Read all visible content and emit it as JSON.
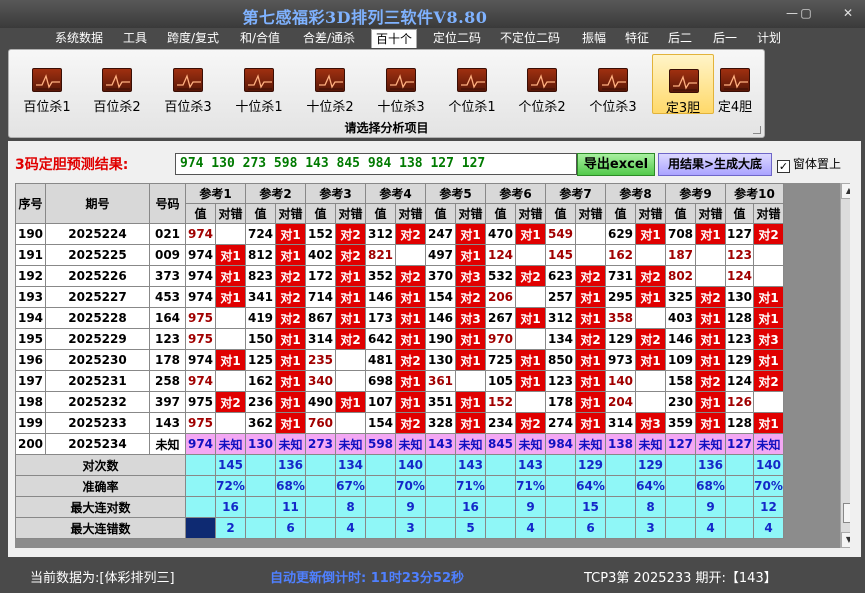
{
  "window": {
    "title": "第七感福彩3D排列三软件V8.80",
    "min": "—",
    "max": "▢",
    "close": "✕"
  },
  "menu": [
    "系统数据",
    "工具",
    "跨度/复式",
    "和/合值",
    "合差/通杀",
    "百十个",
    "定位二码",
    "不定位二码",
    "振幅",
    "特征",
    "后二",
    "后一",
    "计划"
  ],
  "menu_active": "百十个",
  "ribbon": {
    "buttons": [
      "百位杀1",
      "百位杀2",
      "百位杀3",
      "十位杀1",
      "十位杀2",
      "十位杀3",
      "个位杀1",
      "个位杀2",
      "个位杀3",
      "定3胆",
      "定4胆"
    ],
    "active": "定3胆",
    "caption": "请选择分析项目"
  },
  "result": {
    "label": "3码定胆预测结果:",
    "value": "974 130 273 598 143 845 984 138 127 127",
    "export_label": "导出excel",
    "apply_label": "用结果>生成大底",
    "pin_label": "窗体置上",
    "pin_checked": "✓"
  },
  "table": {
    "headers": {
      "seq": "序号",
      "period": "期号",
      "code": "号码",
      "value": "值",
      "mark": "对错"
    },
    "refs": [
      "参考1",
      "参考2",
      "参考3",
      "参考4",
      "参考5",
      "参考6",
      "参考7",
      "参考8",
      "参考9",
      "参考10"
    ],
    "rows": [
      {
        "seq": "190",
        "period": "2025224",
        "code": "021",
        "cells": [
          [
            "974",
            ""
          ],
          [
            "724",
            "对1"
          ],
          [
            "152",
            "对2"
          ],
          [
            "312",
            "对2"
          ],
          [
            "247",
            "对1"
          ],
          [
            "470",
            "对1"
          ],
          [
            "549",
            ""
          ],
          [
            "629",
            "对1"
          ],
          [
            "708",
            "对1"
          ],
          [
            "127",
            "对2"
          ]
        ]
      },
      {
        "seq": "191",
        "period": "2025225",
        "code": "009",
        "cells": [
          [
            "974",
            "对1"
          ],
          [
            "812",
            "对1"
          ],
          [
            "402",
            "对2"
          ],
          [
            "821",
            ""
          ],
          [
            "497",
            "对1"
          ],
          [
            "124",
            ""
          ],
          [
            "145",
            ""
          ],
          [
            "162",
            ""
          ],
          [
            "187",
            ""
          ],
          [
            "123",
            ""
          ]
        ]
      },
      {
        "seq": "192",
        "period": "2025226",
        "code": "373",
        "cells": [
          [
            "974",
            "对1"
          ],
          [
            "823",
            "对2"
          ],
          [
            "172",
            "对1"
          ],
          [
            "352",
            "对2"
          ],
          [
            "370",
            "对3"
          ],
          [
            "532",
            "对2"
          ],
          [
            "623",
            "对2"
          ],
          [
            "731",
            "对2"
          ],
          [
            "802",
            ""
          ],
          [
            "124",
            ""
          ]
        ]
      },
      {
        "seq": "193",
        "period": "2025227",
        "code": "453",
        "cells": [
          [
            "974",
            "对1"
          ],
          [
            "341",
            "对2"
          ],
          [
            "714",
            "对1"
          ],
          [
            "146",
            "对1"
          ],
          [
            "154",
            "对2"
          ],
          [
            "206",
            ""
          ],
          [
            "257",
            "对1"
          ],
          [
            "295",
            "对1"
          ],
          [
            "325",
            "对2"
          ],
          [
            "130",
            "对1"
          ]
        ]
      },
      {
        "seq": "194",
        "period": "2025228",
        "code": "164",
        "cells": [
          [
            "975",
            ""
          ],
          [
            "419",
            "对2"
          ],
          [
            "867",
            "对1"
          ],
          [
            "173",
            "对1"
          ],
          [
            "146",
            "对3"
          ],
          [
            "267",
            "对1"
          ],
          [
            "312",
            "对1"
          ],
          [
            "358",
            ""
          ],
          [
            "403",
            "对1"
          ],
          [
            "128",
            "对1"
          ]
        ]
      },
      {
        "seq": "195",
        "period": "2025229",
        "code": "123",
        "cells": [
          [
            "975",
            ""
          ],
          [
            "150",
            "对1"
          ],
          [
            "314",
            "对2"
          ],
          [
            "642",
            "对1"
          ],
          [
            "190",
            "对1"
          ],
          [
            "970",
            ""
          ],
          [
            "134",
            "对2"
          ],
          [
            "129",
            "对2"
          ],
          [
            "146",
            "对1"
          ],
          [
            "123",
            "对3"
          ]
        ]
      },
      {
        "seq": "196",
        "period": "2025230",
        "code": "178",
        "cells": [
          [
            "974",
            "对1"
          ],
          [
            "125",
            "对1"
          ],
          [
            "235",
            ""
          ],
          [
            "481",
            "对2"
          ],
          [
            "130",
            "对1"
          ],
          [
            "725",
            "对1"
          ],
          [
            "850",
            "对1"
          ],
          [
            "973",
            "对1"
          ],
          [
            "109",
            "对1"
          ],
          [
            "129",
            "对1"
          ]
        ]
      },
      {
        "seq": "197",
        "period": "2025231",
        "code": "258",
        "cells": [
          [
            "974",
            ""
          ],
          [
            "162",
            "对1"
          ],
          [
            "340",
            ""
          ],
          [
            "698",
            "对1"
          ],
          [
            "361",
            ""
          ],
          [
            "105",
            "对1"
          ],
          [
            "123",
            "对1"
          ],
          [
            "140",
            ""
          ],
          [
            "158",
            "对2"
          ],
          [
            "124",
            "对2"
          ]
        ]
      },
      {
        "seq": "198",
        "period": "2025232",
        "code": "397",
        "cells": [
          [
            "975",
            "对2"
          ],
          [
            "236",
            "对1"
          ],
          [
            "490",
            "对1"
          ],
          [
            "107",
            "对1"
          ],
          [
            "351",
            "对1"
          ],
          [
            "152",
            ""
          ],
          [
            "178",
            "对1"
          ],
          [
            "204",
            ""
          ],
          [
            "230",
            "对1"
          ],
          [
            "126",
            ""
          ]
        ]
      },
      {
        "seq": "199",
        "period": "2025233",
        "code": "143",
        "cells": [
          [
            "975",
            ""
          ],
          [
            "362",
            "对1"
          ],
          [
            "760",
            ""
          ],
          [
            "154",
            "对2"
          ],
          [
            "328",
            "对1"
          ],
          [
            "234",
            "对2"
          ],
          [
            "274",
            "对1"
          ],
          [
            "314",
            "对3"
          ],
          [
            "359",
            "对1"
          ],
          [
            "128",
            "对1"
          ]
        ]
      },
      {
        "seq": "200",
        "period": "2025234",
        "code": "未知",
        "cells": [
          [
            "974",
            "未知"
          ],
          [
            "130",
            "未知"
          ],
          [
            "273",
            "未知"
          ],
          [
            "598",
            "未知"
          ],
          [
            "143",
            "未知"
          ],
          [
            "845",
            "未知"
          ],
          [
            "984",
            "未知"
          ],
          [
            "138",
            "未知"
          ],
          [
            "127",
            "未知"
          ],
          [
            "127",
            "未知"
          ]
        ]
      }
    ],
    "stats": [
      {
        "label": "对次数",
        "values": [
          "145",
          "136",
          "134",
          "140",
          "143",
          "143",
          "129",
          "129",
          "136",
          "140"
        ]
      },
      {
        "label": "准确率",
        "values": [
          "72%",
          "68%",
          "67%",
          "70%",
          "71%",
          "71%",
          "64%",
          "64%",
          "68%",
          "70%"
        ]
      },
      {
        "label": "最大连对数",
        "values": [
          "16",
          "11",
          "8",
          "9",
          "16",
          "9",
          "15",
          "8",
          "9",
          "12"
        ]
      },
      {
        "label": "最大连错数",
        "values": [
          "2",
          "6",
          "4",
          "3",
          "5",
          "4",
          "6",
          "3",
          "4",
          "4"
        ]
      }
    ]
  },
  "status": {
    "source": "当前数据为:[体彩排列三]",
    "timer": "自动更新倒计时: 11时23分52秒",
    "draw": "TCP3第 2025233 期开:【143】"
  }
}
